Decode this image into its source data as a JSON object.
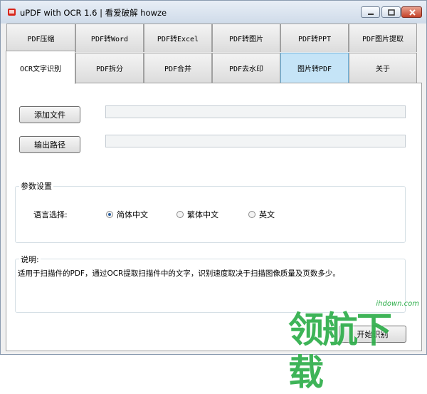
{
  "window": {
    "title": "uPDF with OCR 1.6 |  看爱破解 howze"
  },
  "tabs_row1": [
    {
      "label": "PDF压缩"
    },
    {
      "label": "PDF转Word"
    },
    {
      "label": "PDF转Excel"
    },
    {
      "label": "PDF转图片"
    },
    {
      "label": "PDF转PPT"
    },
    {
      "label": "PDF图片提取"
    }
  ],
  "tabs_row2": [
    {
      "label": "OCR文字识别",
      "active": true
    },
    {
      "label": "PDF拆分"
    },
    {
      "label": "PDF合并"
    },
    {
      "label": "PDF去水印"
    },
    {
      "label": "图片转PDF",
      "highlighted": true
    },
    {
      "label": "关于"
    }
  ],
  "main": {
    "add_file_button": "添加文件",
    "output_path_button": "输出路径",
    "add_file_value": "",
    "output_path_value": "",
    "params_group_title": "参数设置",
    "language_label": "语言选择:",
    "languages": [
      {
        "label": "简体中文",
        "selected": true
      },
      {
        "label": "繁体中文",
        "selected": false
      },
      {
        "label": "英文",
        "selected": false
      }
    ],
    "desc_group_title": "说明:",
    "description": "适用于扫描件的PDF，通过OCR提取扫描件中的文字，识别速度取决于扫描图像质量及页数多少。",
    "start_button": "开始识别"
  },
  "watermark": {
    "site": "ihdown.com",
    "brand": "领航下载"
  },
  "colors": {
    "highlight_tab": "#c5e4f7",
    "watermark_green": "#2eae4a",
    "radio_selected": "#2a5fa0"
  }
}
